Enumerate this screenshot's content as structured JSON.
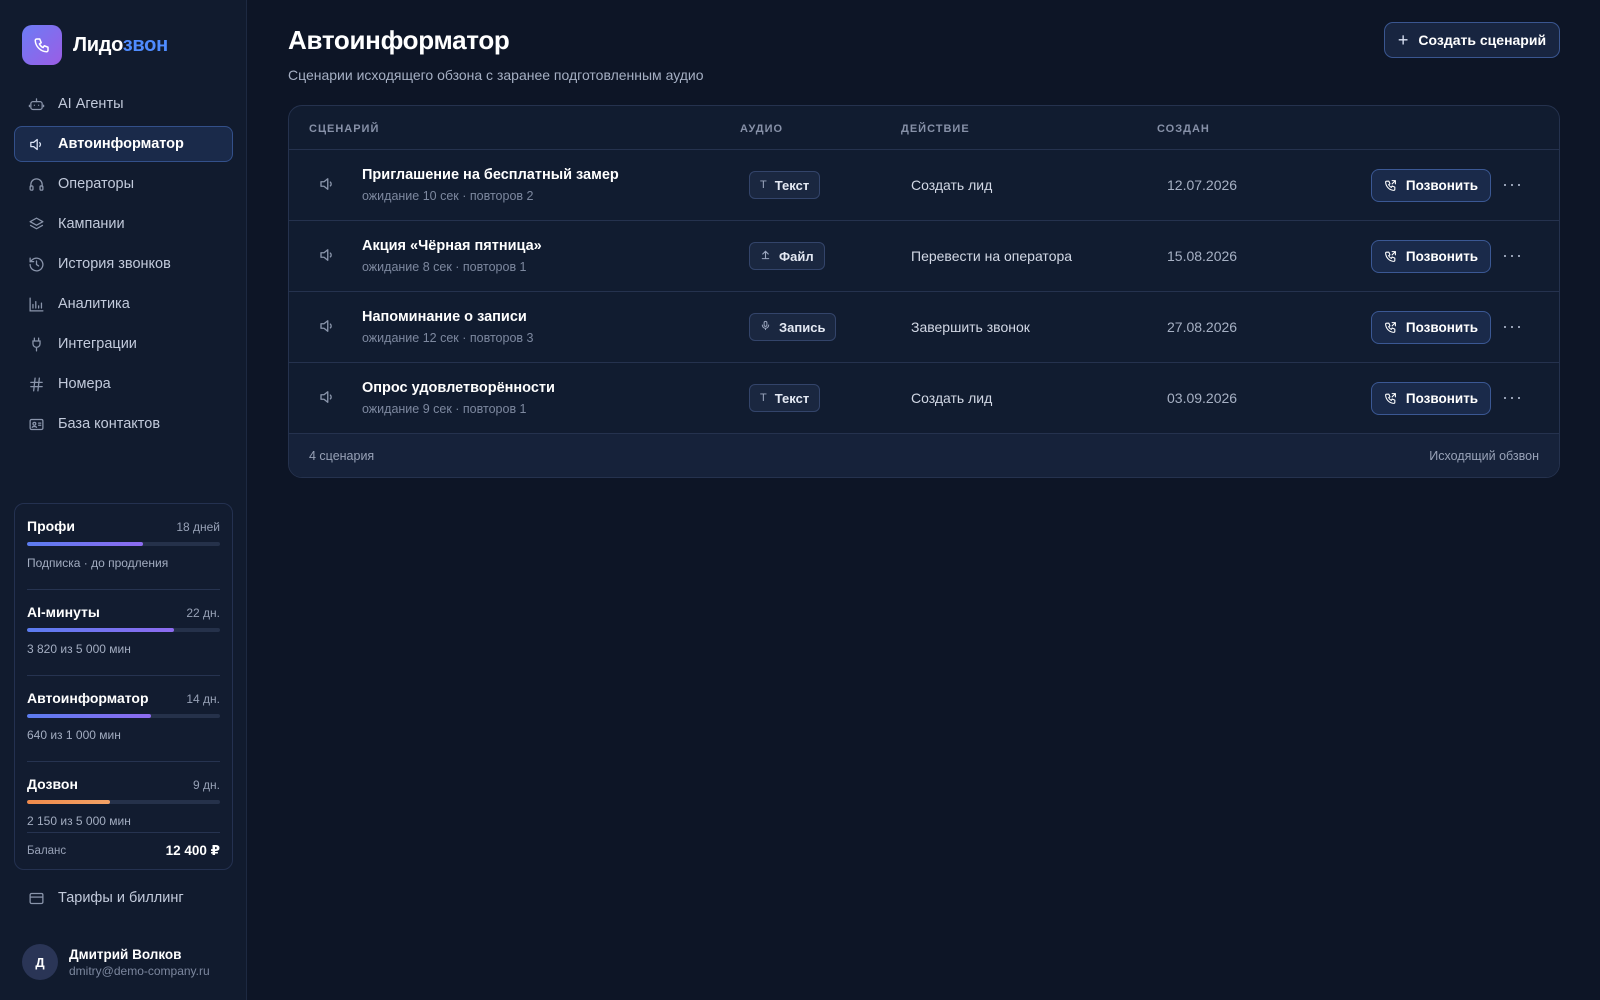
{
  "brand": {
    "part1": "Лидо",
    "part2": "звон",
    "accent": "#4f8cff"
  },
  "sidebar": {
    "items": [
      {
        "label": "AI Агенты",
        "icon": "robot-icon"
      },
      {
        "label": "Автоинформатор",
        "icon": "speaker-icon",
        "active": true
      },
      {
        "label": "Операторы",
        "icon": "headset-icon"
      },
      {
        "label": "Кампании",
        "icon": "layers-icon"
      },
      {
        "label": "История звонков",
        "icon": "history-icon"
      },
      {
        "label": "Аналитика",
        "icon": "chart-icon"
      },
      {
        "label": "Интеграции",
        "icon": "plug-icon"
      },
      {
        "label": "Номера",
        "icon": "hash-icon"
      },
      {
        "label": "База контактов",
        "icon": "contact-card-icon"
      }
    ],
    "usage": [
      {
        "name": "Профи",
        "days": "18 дней",
        "sub": "Подписка · до продления",
        "progress": 0.6
      },
      {
        "name": "AI-минуты",
        "days": "22 дн.",
        "sub": "3 820 из 5 000 мин",
        "progress": 0.764
      },
      {
        "name": "Автоинформатор",
        "days": "14 дн.",
        "sub": "640 из 1 000 мин",
        "progress": 0.64
      },
      {
        "name": "Дозвон",
        "days": "9 дн.",
        "sub": "2 150 из 5 000 мин",
        "progress": 0.43,
        "color": "orange"
      }
    ],
    "balance_label": "Баланс",
    "balance_value": "12 400 ₽",
    "billing_label": "Тарифы и биллинг"
  },
  "user": {
    "initial": "Д",
    "name": "Дмитрий Волков",
    "email": "dmitry@demo-company.ru"
  },
  "page": {
    "title": "Автоинформатор",
    "subtitle": "Сценарии исходящего обзона с заранее подготовленным аудио",
    "create_label": "Создать сценарий"
  },
  "table": {
    "headers": {
      "scenario": "СЦЕНАРИЙ",
      "audio": "АУДИО",
      "action": "ДЕЙСТВИЕ",
      "created": "СОЗДАН"
    },
    "rows": [
      {
        "title": "Приглашение на бесплатный замер",
        "meta": "ожидание 10 сек · повторов 2",
        "audio": "Текст",
        "audio_icon": "text-icon",
        "action": "Создать лид",
        "created": "12.07.2026",
        "call": "Позвонить"
      },
      {
        "title": "Акция «Чёрная пятница»",
        "meta": "ожидание 8 сек · повторов 1",
        "audio": "Файл",
        "audio_icon": "upload-icon",
        "action": "Перевести на оператора",
        "created": "15.08.2026",
        "call": "Позвонить"
      },
      {
        "title": "Напоминание о записи",
        "meta": "ожидание 12 сек · повторов 3",
        "audio": "Запись",
        "audio_icon": "mic-icon",
        "action": "Завершить звонок",
        "created": "27.08.2026",
        "call": "Позвонить"
      },
      {
        "title": "Опрос удовлетворённости",
        "meta": "ожидание 9 сек · повторов 1",
        "audio": "Текст",
        "audio_icon": "text-icon",
        "action": "Создать лид",
        "created": "03.09.2026",
        "call": "Позвонить"
      }
    ],
    "footer_left": "4 сценария",
    "footer_right": "Исходящий обзвон"
  }
}
